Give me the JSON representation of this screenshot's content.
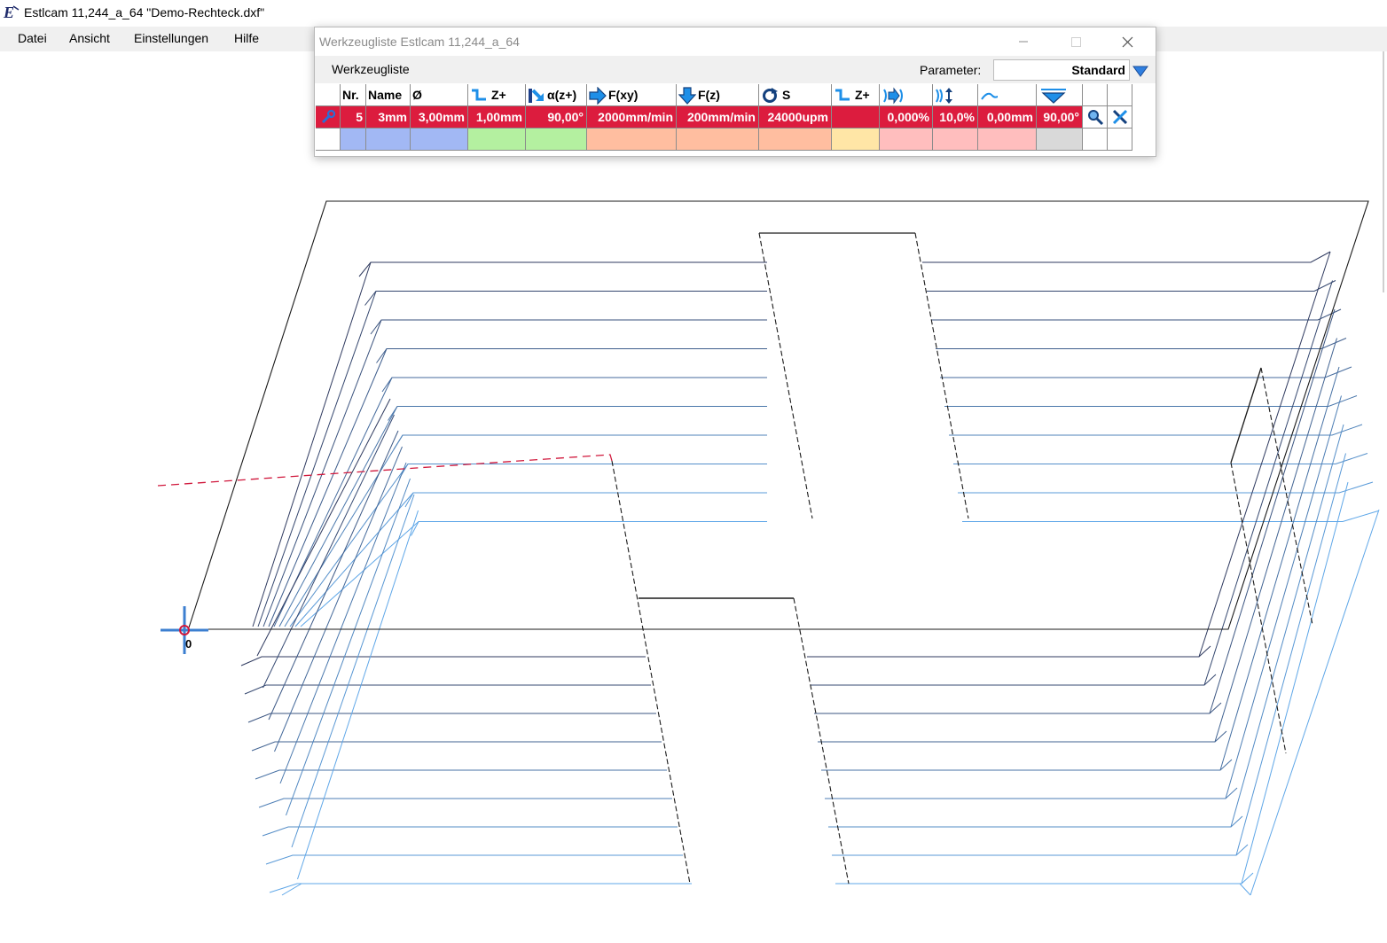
{
  "app": {
    "title": "Estlcam 11,244_a_64 \"Demo-Rechteck.dxf\""
  },
  "menu": [
    "Datei",
    "Ansicht",
    "Einstellungen",
    "Hilfe"
  ],
  "tool_window": {
    "title": "Werkzeugliste Estlcam 11,244_a_64",
    "menu_label": "Werkzeugliste",
    "parameter_label": "Parameter:",
    "parameter_value": "Standard",
    "columns": [
      {
        "label": "",
        "icon": "tool-type-icon"
      },
      {
        "label": "Nr.",
        "icon": ""
      },
      {
        "label": "Name",
        "icon": ""
      },
      {
        "label": "Ø",
        "icon": ""
      },
      {
        "label": "Z+",
        "icon": "step-down-icon"
      },
      {
        "label": "α(z+)",
        "icon": "plunge-angle-icon"
      },
      {
        "label": "F(xy)",
        "icon": "feed-xy-arrow-icon"
      },
      {
        "label": "F(z)",
        "icon": "feed-z-arrow-icon"
      },
      {
        "label": "S",
        "icon": "spindle-rotation-icon"
      },
      {
        "label": "Z+",
        "icon": "finish-step-icon"
      },
      {
        "label": "",
        "icon": "finish-offset-icon"
      },
      {
        "label": "",
        "icon": "overlap-icon"
      },
      {
        "label": "",
        "icon": "wave-icon"
      },
      {
        "label": "",
        "icon": "cone-angle-icon"
      },
      {
        "label": "",
        "icon": ""
      },
      {
        "label": "",
        "icon": ""
      }
    ],
    "row": [
      "",
      "5",
      "3mm",
      "3,00mm",
      "1,00mm",
      "90,00°",
      "2000mm/min",
      "200mm/min",
      "24000upm",
      "",
      "0,000%",
      "10,0%",
      "0,00mm",
      "90,00°",
      "",
      ""
    ],
    "group_colors": [
      "#ffffff",
      "#a2b8f4",
      "#a2b8f4",
      "#a2b8f4",
      "#b4f0a0",
      "#b4f0a0",
      "#ffbea0",
      "#ffbea0",
      "#ffbea0",
      "#ffe6a6",
      "#ffbebe",
      "#ffbebe",
      "#ffbebe",
      "#d9d9d9",
      "#ffffff",
      "#ffffff"
    ],
    "selected_row_color": "#dc1c3e",
    "row_actions": [
      "search-icon",
      "delete-tool-icon"
    ]
  },
  "viewport": {
    "origin_label": "0",
    "colors": {
      "outline": "#1a1a1a",
      "toolpath_dark": "#2f3a5f",
      "toolpath_light": "#5fa7e8",
      "rapid": "#d0183c",
      "origin_marker": "#3c7fd0"
    }
  }
}
